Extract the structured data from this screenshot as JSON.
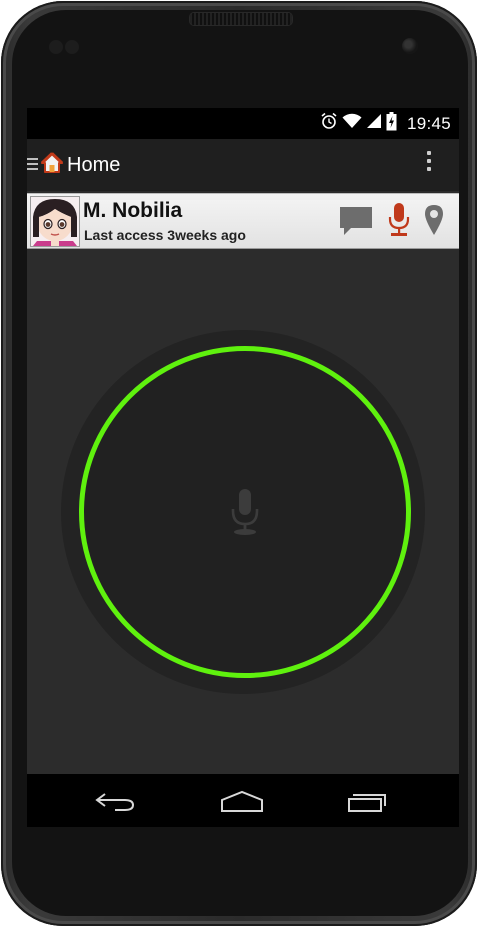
{
  "status_bar": {
    "time": "19:45",
    "icons": [
      "alarm-icon",
      "wifi-icon",
      "signal-icon",
      "battery-charging-icon"
    ]
  },
  "action_bar": {
    "title": "Home",
    "icons": [
      "drawer-menu-icon",
      "home-icon",
      "overflow-menu-icon"
    ]
  },
  "contact": {
    "name": "M. Nobilia",
    "last_access": "Last access 3weeks ago",
    "actions": [
      "chat-icon",
      "microphone-icon",
      "location-pin-icon"
    ]
  },
  "voice": {
    "state_color": "#5ff10e",
    "icon": "microphone-icon"
  },
  "nav_bar": {
    "buttons": [
      "back-icon",
      "home-icon",
      "recent-apps-icon"
    ]
  },
  "colors": {
    "accent_green": "#5ff10e",
    "mic_active": "#c0391b",
    "screen_bg": "#2c2c2c"
  }
}
